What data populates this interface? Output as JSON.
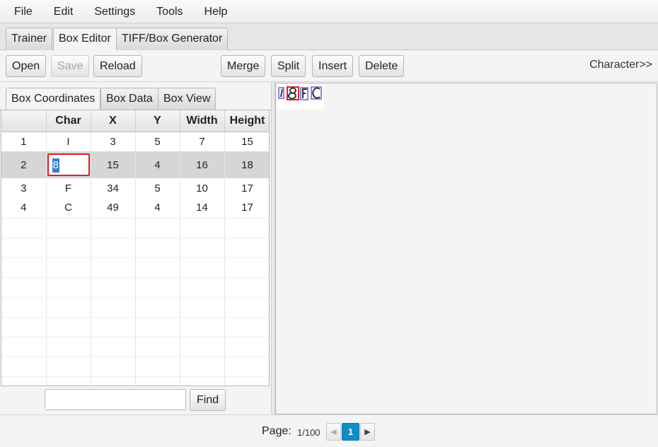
{
  "menu": [
    "File",
    "Edit",
    "Settings",
    "Tools",
    "Help"
  ],
  "top_tabs": [
    "Trainer",
    "Box Editor",
    "TIFF/Box Generator"
  ],
  "toolbar": {
    "open": "Open",
    "save": "Save",
    "reload": "Reload",
    "merge": "Merge",
    "split": "Split",
    "insert": "Insert",
    "delete": "Delete",
    "characters": "Character>>"
  },
  "inner_tabs": [
    "Box Coordinates",
    "Box Data",
    "Box View"
  ],
  "table": {
    "headers": [
      "",
      "Char",
      "X",
      "Y",
      "Width",
      "Height"
    ],
    "rows": [
      [
        "1",
        "I",
        "3",
        "5",
        "7",
        "15"
      ],
      [
        "2",
        "8",
        "15",
        "4",
        "16",
        "18"
      ],
      [
        "3",
        "F",
        "34",
        "5",
        "10",
        "17"
      ],
      [
        "4",
        "C",
        "49",
        "4",
        "14",
        "17"
      ]
    ],
    "selected_row": 2
  },
  "find": {
    "value": "",
    "button": "Find"
  },
  "pagination": {
    "label": "Page:",
    "count": "1/100",
    "current": "1",
    "prev": "◀",
    "next": "▶"
  },
  "colors": {
    "selected_box": "#e02020",
    "box": "#6a5fd8",
    "page_active": "#0d8ec9"
  },
  "image_glyphs": [
    "I",
    "8",
    "F",
    "C"
  ]
}
